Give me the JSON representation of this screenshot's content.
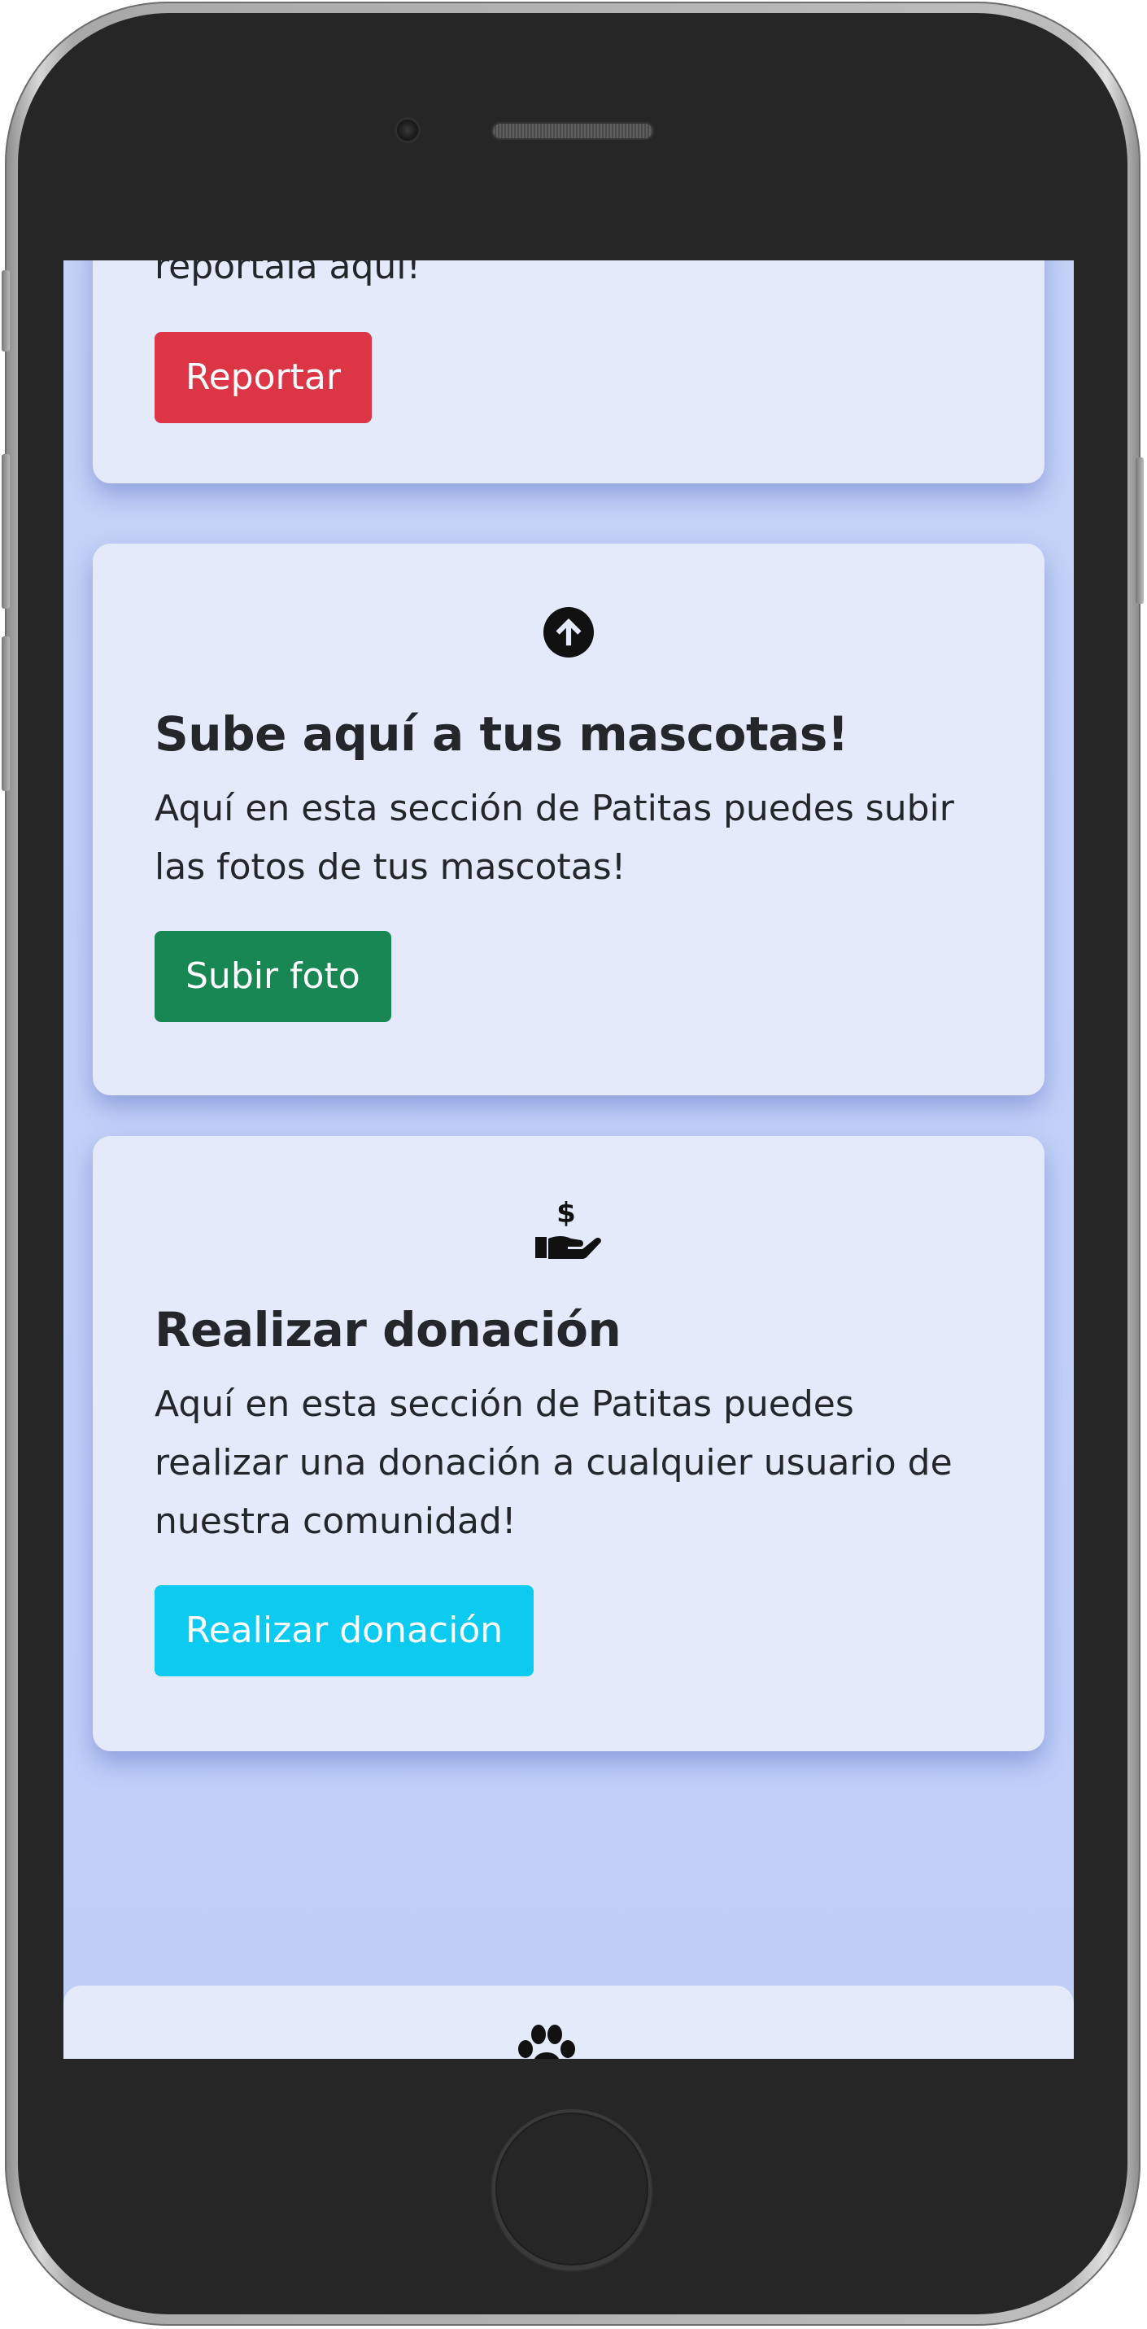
{
  "cards": {
    "report": {
      "partial_text": "reportala aqui!",
      "button_label": "Reportar",
      "button_color": "#dc3545"
    },
    "upload": {
      "icon": "arrow-up-circle-icon",
      "title": "Sube aquí a tus mascotas!",
      "description": "Aquí en esta sección de Patitas puedes subir las fotos de tus mascotas!",
      "button_label": "Subir foto",
      "button_color": "#198754"
    },
    "donation": {
      "icon": "hand-dollar-icon",
      "title": "Realizar donación",
      "description": "Aquí en esta sección de Patitas puedes realizar una donación a cualquier usuario de nuestra comunidad!",
      "button_label": "Realizar donación",
      "button_color": "#0dcaf0"
    },
    "bottom": {
      "icon": "paw-icon"
    }
  },
  "colors": {
    "page_background": "#c5d3f7",
    "card_background": "#e5eafb",
    "text": "#23262b"
  }
}
